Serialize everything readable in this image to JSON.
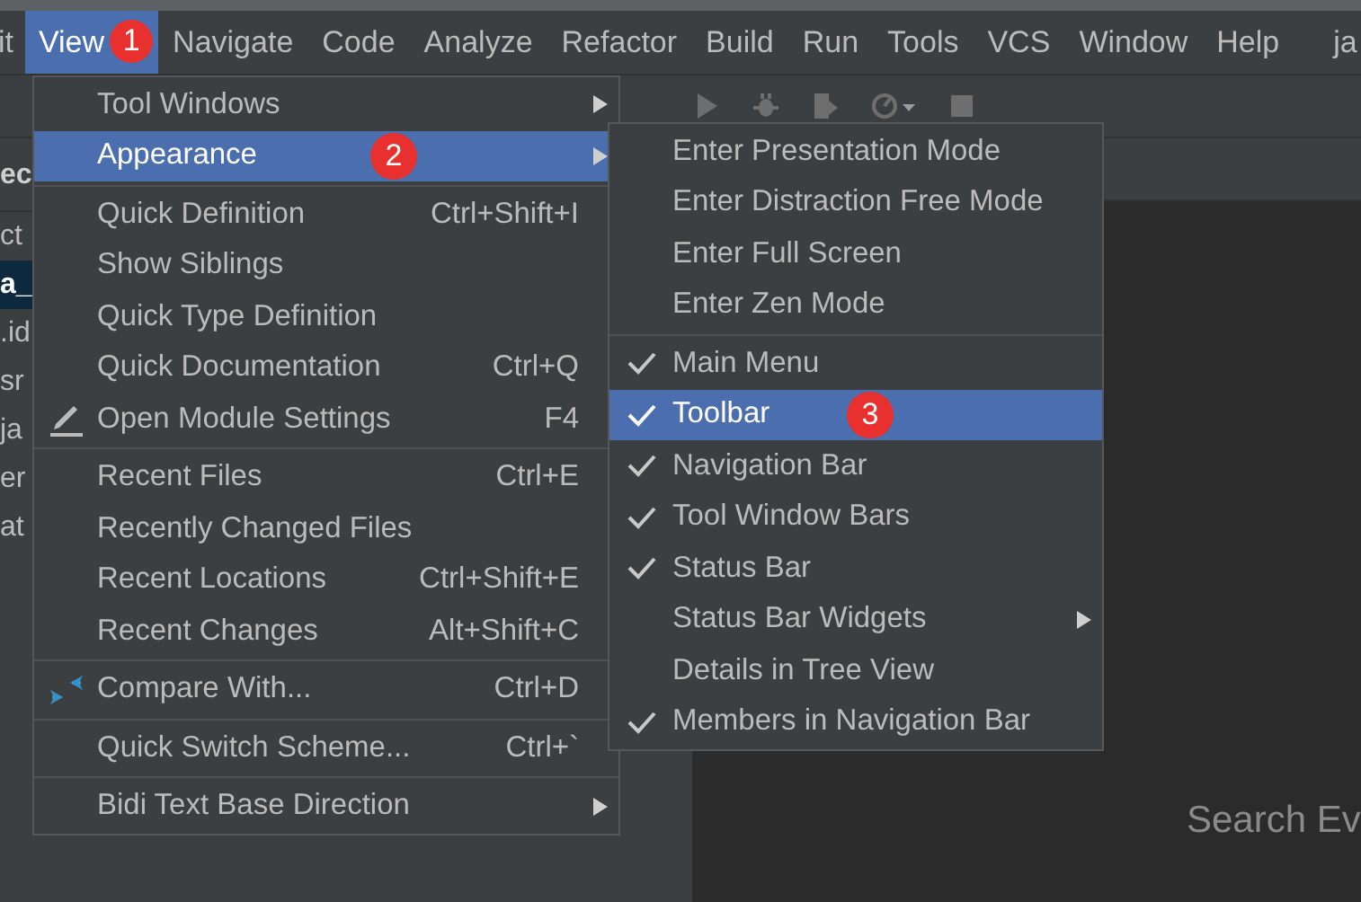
{
  "menu_bar": {
    "items": [
      {
        "label": "it",
        "selected": false
      },
      {
        "label": "View",
        "selected": true,
        "badge": "1"
      },
      {
        "label": "Navigate",
        "selected": false
      },
      {
        "label": "Code",
        "selected": false
      },
      {
        "label": "Analyze",
        "selected": false
      },
      {
        "label": "Refactor",
        "selected": false
      },
      {
        "label": "Build",
        "selected": false
      },
      {
        "label": "Run",
        "selected": false
      },
      {
        "label": "Tools",
        "selected": false
      },
      {
        "label": "VCS",
        "selected": false
      },
      {
        "label": "Window",
        "selected": false
      },
      {
        "label": "Help",
        "selected": false
      }
    ],
    "project_title": "ja"
  },
  "toolbar": {
    "icons": [
      {
        "kind": "run"
      },
      {
        "kind": "debug"
      },
      {
        "kind": "coverage"
      },
      {
        "kind": "profile"
      },
      {
        "kind": "stop"
      }
    ]
  },
  "project_panel": {
    "header": "ec",
    "rows": [
      {
        "label": "ct",
        "selected": false
      },
      {
        "label": "a_",
        "selected": true
      },
      {
        "label": ".id",
        "selected": false
      },
      {
        "label": "sr",
        "selected": false
      },
      {
        "label": "ja",
        "selected": false
      },
      {
        "label": "er",
        "selected": false
      },
      {
        "label": "at",
        "selected": false
      }
    ]
  },
  "view_menu": {
    "items": [
      {
        "kind": "item",
        "label": "Tool Windows",
        "submenu": true,
        "selected": false
      },
      {
        "kind": "item",
        "label": "Appearance",
        "submenu": true,
        "selected": true,
        "badge": "2"
      },
      {
        "kind": "separator"
      },
      {
        "kind": "item",
        "label": "Quick Definition",
        "shortcut": "Ctrl+Shift+I",
        "selected": false
      },
      {
        "kind": "item",
        "label": "Show Siblings",
        "selected": false
      },
      {
        "kind": "item",
        "label": "Quick Type Definition",
        "selected": false
      },
      {
        "kind": "item",
        "label": "Quick Documentation",
        "shortcut": "Ctrl+Q",
        "selected": false
      },
      {
        "kind": "edit",
        "label": "Open Module Settings",
        "shortcut": "F4",
        "selected": false
      },
      {
        "kind": "separator"
      },
      {
        "kind": "item",
        "label": "Recent Files",
        "shortcut": "Ctrl+E",
        "selected": false
      },
      {
        "kind": "item",
        "label": "Recently Changed Files",
        "selected": false
      },
      {
        "kind": "item",
        "label": "Recent Locations",
        "shortcut": "Ctrl+Shift+E",
        "selected": false
      },
      {
        "kind": "item",
        "label": "Recent Changes",
        "shortcut": "Alt+Shift+C",
        "selected": false
      },
      {
        "kind": "separator"
      },
      {
        "kind": "compare",
        "label": "Compare With...",
        "shortcut": "Ctrl+D",
        "selected": false
      },
      {
        "kind": "separator"
      },
      {
        "kind": "item",
        "label": "Quick Switch Scheme...",
        "shortcut": "Ctrl+`",
        "selected": false
      },
      {
        "kind": "separator"
      },
      {
        "kind": "item",
        "label": "Bidi Text Base Direction",
        "submenu": true,
        "selected": false
      }
    ]
  },
  "appearance_menu": {
    "items": [
      {
        "kind": "item",
        "label": "Enter Presentation Mode",
        "checked": false,
        "selected": false
      },
      {
        "kind": "item",
        "label": "Enter Distraction Free Mode",
        "checked": false,
        "selected": false
      },
      {
        "kind": "item",
        "label": "Enter Full Screen",
        "checked": false,
        "selected": false
      },
      {
        "kind": "item",
        "label": "Enter Zen Mode",
        "checked": false,
        "selected": false
      },
      {
        "kind": "separator"
      },
      {
        "kind": "item",
        "label": "Main Menu",
        "checked": true,
        "selected": false
      },
      {
        "kind": "item",
        "label": "Toolbar",
        "checked": true,
        "selected": true,
        "badge": "3"
      },
      {
        "kind": "item",
        "label": "Navigation Bar",
        "checked": true,
        "selected": false
      },
      {
        "kind": "item",
        "label": "Tool Window Bars",
        "checked": true,
        "selected": false
      },
      {
        "kind": "item",
        "label": "Status Bar",
        "checked": true,
        "selected": false
      },
      {
        "kind": "item",
        "label": "Status Bar Widgets",
        "checked": false,
        "submenu": true,
        "selected": false
      },
      {
        "kind": "item",
        "label": "Details in Tree View",
        "checked": false,
        "selected": false
      },
      {
        "kind": "item",
        "label": "Members in Navigation Bar",
        "checked": true,
        "selected": false
      }
    ]
  },
  "editor": {
    "hint": "Search Ev"
  }
}
